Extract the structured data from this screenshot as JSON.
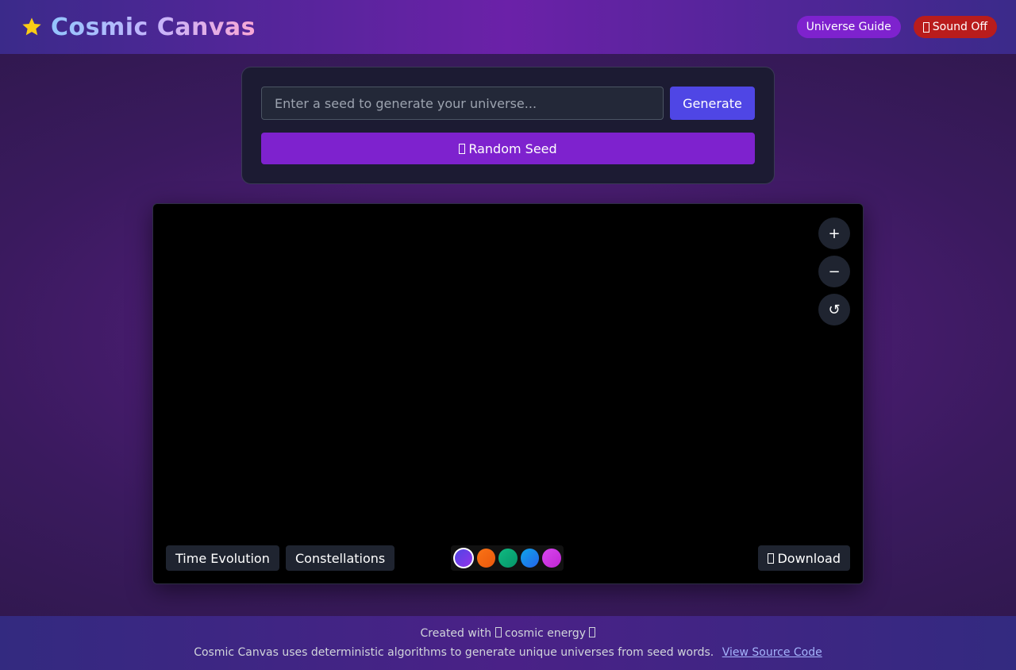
{
  "header": {
    "title": "Cosmic Canvas",
    "logo_icon": "star-icon",
    "guide_label": "Universe Guide",
    "sound_label": "Sound Off",
    "sound_icon": "speaker-muted-icon"
  },
  "seed": {
    "placeholder": "Enter a seed to generate your universe...",
    "value": "",
    "generate_label": "Generate",
    "random_label": "Random Seed",
    "random_icon": "dice-icon"
  },
  "canvas": {
    "zoom_in": "+",
    "zoom_out": "−",
    "reset": "↺",
    "time_evolution_label": "Time Evolution",
    "constellations_label": "Constellations",
    "download_label": "Download",
    "download_icon": "download-icon",
    "palettes": [
      {
        "name": "indigo-purple",
        "from": "#4f46e5",
        "to": "#9333ea",
        "selected": true
      },
      {
        "name": "orange",
        "from": "#f97316",
        "to": "#ea580c",
        "selected": false
      },
      {
        "name": "green",
        "from": "#10b981",
        "to": "#059669",
        "selected": false
      },
      {
        "name": "blue",
        "from": "#0ea5e9",
        "to": "#2563eb",
        "selected": false
      },
      {
        "name": "magenta",
        "from": "#d946ef",
        "to": "#c026d3",
        "selected": false
      }
    ]
  },
  "footer": {
    "line1_prefix": "Created with",
    "line1_middle": "cosmic energy",
    "description": "Cosmic Canvas uses deterministic algorithms to generate unique universes from seed words.",
    "source_link": "View Source Code"
  },
  "colors": {
    "accent_purple": "#7e22ce",
    "accent_indigo": "#4f46e5",
    "sound_red": "#b91c1c",
    "logo_gold": "#facc15"
  }
}
